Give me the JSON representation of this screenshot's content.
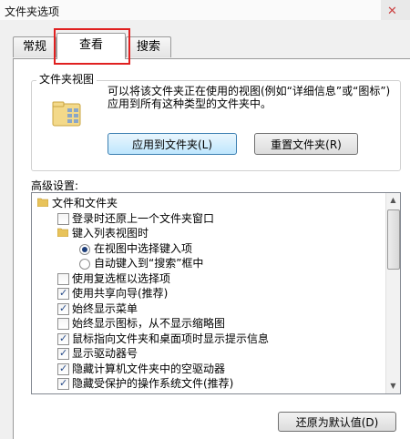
{
  "window": {
    "title": "文件夹选项"
  },
  "tabs": [
    {
      "label": "常规"
    },
    {
      "label": "查看"
    },
    {
      "label": "搜索"
    }
  ],
  "folder_views": {
    "title": "文件夹视图",
    "description": "可以将该文件夹正在使用的视图(例如“详细信息”或“图标”)应用到所有这种类型的文件夹中。",
    "apply_button": "应用到文件夹(L)",
    "reset_button": "重置文件夹(R)"
  },
  "advanced": {
    "label": "高级设置:",
    "items": [
      {
        "type": "folder",
        "level": 0,
        "label": "文件和文件夹"
      },
      {
        "type": "checkbox",
        "level": 1,
        "checked": false,
        "label": "登录时还原上一个文件夹窗口"
      },
      {
        "type": "folder",
        "level": 1,
        "label": "键入列表视图时"
      },
      {
        "type": "radio",
        "level": 2,
        "checked": true,
        "label": "在视图中选择键入项"
      },
      {
        "type": "radio",
        "level": 2,
        "checked": false,
        "label": "自动键入到“搜索”框中"
      },
      {
        "type": "checkbox",
        "level": 1,
        "checked": false,
        "label": "使用复选框以选择项"
      },
      {
        "type": "checkbox",
        "level": 1,
        "checked": true,
        "label": "使用共享向导(推荐)"
      },
      {
        "type": "checkbox",
        "level": 1,
        "checked": true,
        "label": "始终显示菜单"
      },
      {
        "type": "checkbox",
        "level": 1,
        "checked": false,
        "label": "始终显示图标，从不显示缩略图"
      },
      {
        "type": "checkbox",
        "level": 1,
        "checked": true,
        "label": "鼠标指向文件夹和桌面项时显示提示信息"
      },
      {
        "type": "checkbox",
        "level": 1,
        "checked": true,
        "label": "显示驱动器号"
      },
      {
        "type": "checkbox",
        "level": 1,
        "checked": true,
        "label": "隐藏计算机文件夹中的空驱动器"
      },
      {
        "type": "checkbox",
        "level": 1,
        "checked": true,
        "label": "隐藏受保护的操作系统文件(推荐)"
      }
    ],
    "restore_button": "还原为默认值(D)"
  },
  "colors": {
    "highlight": "#e02020",
    "folder": "#e8c35a"
  }
}
